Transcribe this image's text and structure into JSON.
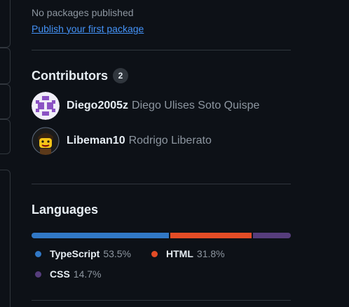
{
  "packages": {
    "empty_text": "No packages published",
    "link_text": "Publish your first package"
  },
  "contributors": {
    "title": "Contributors",
    "count": "2",
    "items": [
      {
        "login": "Diego2005z",
        "name": "Diego Ulises Soto Quispe",
        "avatar_icon": "identicon-avatar"
      },
      {
        "login": "Libeman10",
        "name": "Rodrigo Liberato",
        "avatar_icon": "lego-figure-avatar"
      }
    ]
  },
  "languages": {
    "title": "Languages",
    "items": [
      {
        "name": "TypeScript",
        "percent": "53.5%",
        "value": 53.5,
        "color": "#3178c6"
      },
      {
        "name": "HTML",
        "percent": "31.8%",
        "value": 31.8,
        "color": "#e34c26"
      },
      {
        "name": "CSS",
        "percent": "14.7%",
        "value": 14.7,
        "color": "#563d7c"
      }
    ]
  },
  "colors": {
    "background": "#0d1117",
    "border": "#30363d",
    "link": "#4493f8",
    "muted": "#8d96a0"
  }
}
